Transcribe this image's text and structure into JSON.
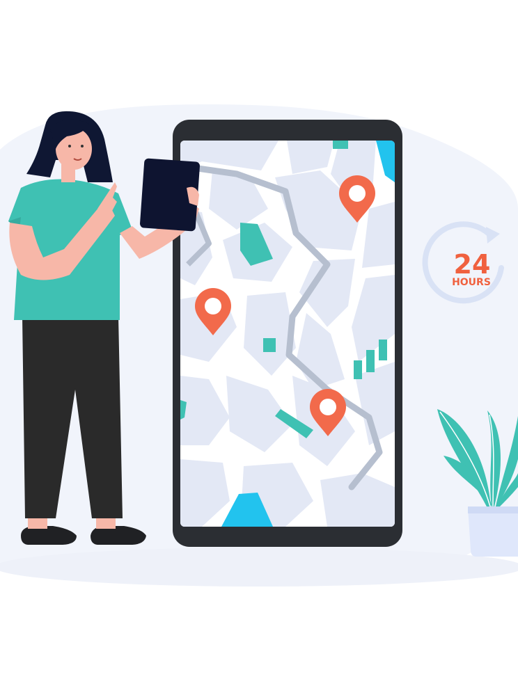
{
  "illustration": {
    "badge": {
      "number": "24",
      "label": "HOURS"
    },
    "icons": [
      "map-pin-icon",
      "map-pin-icon",
      "map-pin-icon",
      "circular-arrow-icon",
      "signal-bars-icon"
    ],
    "colors": {
      "background_blob": "#f1f4fb",
      "phone_frame": "#2b2e33",
      "map_block": "#e3e8f5",
      "map_road": "#ffffff",
      "route": "#b6bfcf",
      "pin": "#f26a4b",
      "teal": "#3fc1b3",
      "water": "#22c3ee",
      "badge_text": "#f0613f",
      "badge_arrow": "#d9e2f5",
      "shirt": "#3fc1b3",
      "pants": "#2a2a2a",
      "hair": "#0f1733",
      "skin": "#f7b7a8",
      "tablet": "#0e1430",
      "pot": "#dfe7fb"
    }
  }
}
